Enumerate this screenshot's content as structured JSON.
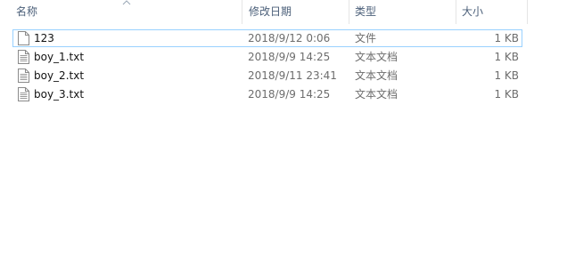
{
  "columns": {
    "name": "名称",
    "date_modified": "修改日期",
    "type": "类型",
    "size": "大小"
  },
  "sort": {
    "column": "name",
    "direction": "ascending",
    "icon": "sort-ascending-icon"
  },
  "files": [
    {
      "name": "123",
      "date": "2018/9/12 0:06",
      "type": "文件",
      "size": "1 KB",
      "icon": "file-icon",
      "focused": true
    },
    {
      "name": "boy_1.txt",
      "date": "2018/9/9 14:25",
      "type": "文本文档",
      "size": "1 KB",
      "icon": "text-file-icon",
      "focused": false
    },
    {
      "name": "boy_2.txt",
      "date": "2018/9/11 23:41",
      "type": "文本文档",
      "size": "1 KB",
      "icon": "text-file-icon",
      "focused": false
    },
    {
      "name": "boy_3.txt",
      "date": "2018/9/9 14:25",
      "type": "文本文档",
      "size": "1 KB",
      "icon": "text-file-icon",
      "focused": false
    }
  ],
  "colors": {
    "header_text": "#4c607a",
    "focus_border": "#99d1ff",
    "secondary_text": "#6d6d6d"
  }
}
